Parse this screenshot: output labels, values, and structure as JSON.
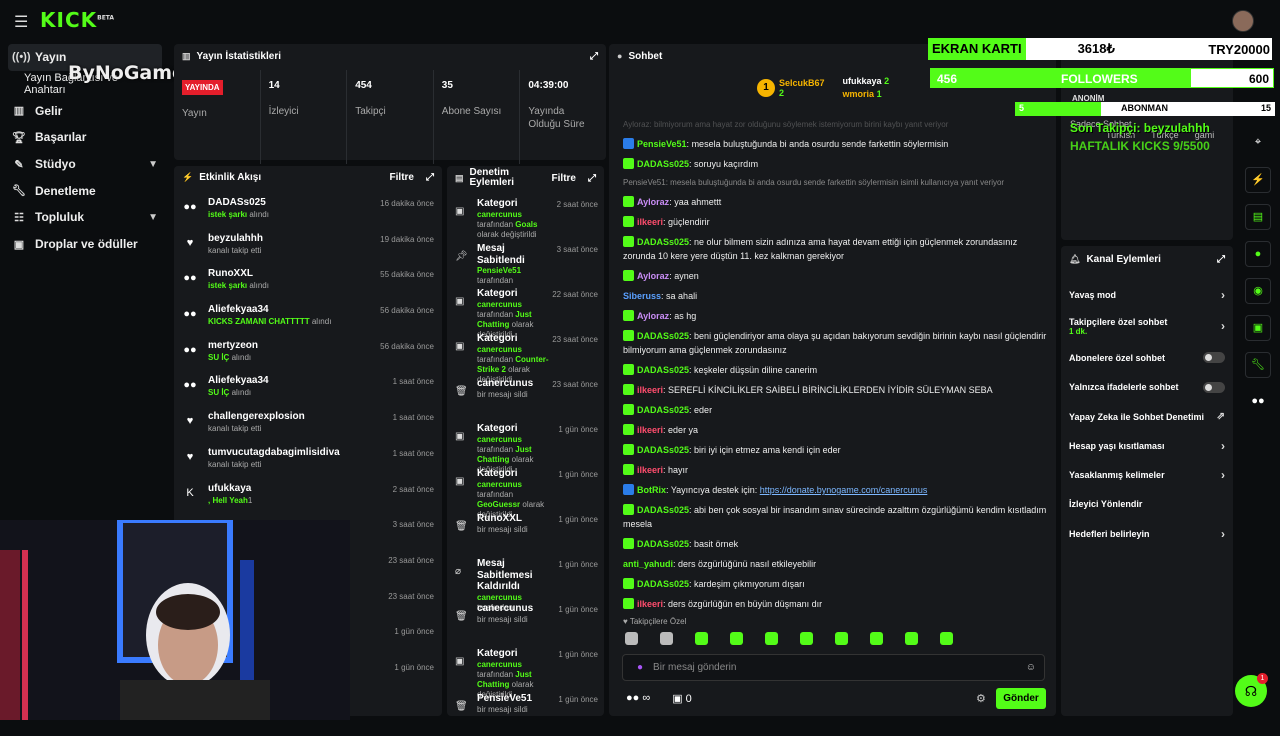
{
  "brand": {
    "logo": "KICK",
    "beta": "BETA"
  },
  "watermark": "ByNoGame",
  "sidebar": {
    "items": [
      {
        "label": "Yayın",
        "icon": "broadcast-icon"
      },
      {
        "label": "Yayın Bağlantısı ve Anahtarı"
      },
      {
        "label": "Gelir",
        "icon": "chart-icon"
      },
      {
        "label": "Başarılar",
        "icon": "trophy-icon"
      },
      {
        "label": "Stüdyo",
        "icon": "studio-icon"
      },
      {
        "label": "Denetleme",
        "icon": "wrench-icon"
      },
      {
        "label": "Topluluk",
        "icon": "community-icon"
      },
      {
        "label": "Droplar ve ödüller",
        "icon": "gift-icon"
      }
    ]
  },
  "stats": {
    "title": "Yayın İstatistikleri",
    "live": "YAYINDA",
    "items": [
      {
        "value": "",
        "label": "Yayın"
      },
      {
        "value": "14",
        "label": "İzleyici"
      },
      {
        "value": "454",
        "label": "Takipçi"
      },
      {
        "value": "35",
        "label": "Abone Sayısı"
      },
      {
        "value": "04:39:00",
        "label": "Yayında Olduğu Süre"
      }
    ]
  },
  "activity": {
    "title": "Etkinlik Akışı",
    "filter": "Filtre",
    "rows": [
      {
        "name": "DADASs025",
        "desc": "istek şarkı",
        "desc2": " alındı",
        "time": "16 dakika önce",
        "icon": "people-icon"
      },
      {
        "name": "beyzulahhh",
        "desc": "kanalı takip etti",
        "time": "19 dakika önce",
        "icon": "heart-icon"
      },
      {
        "name": "RunoXXL",
        "desc": "istek şarkı",
        "desc2": " alındı",
        "time": "55 dakika önce",
        "icon": "people-icon"
      },
      {
        "name": "Aliefekyaa34",
        "desc": "KICKS ZAMANI CHATTTTT",
        "desc2": " alındı",
        "time": "56 dakika önce",
        "icon": "people-icon"
      },
      {
        "name": "mertyzeon",
        "desc": "SU İÇ",
        "desc2": " alındı",
        "time": "56 dakika önce",
        "icon": "people-icon"
      },
      {
        "name": "Aliefekyaa34",
        "desc": "SU İÇ",
        "desc2": " alındı",
        "time": "1 saat önce",
        "icon": "people-icon"
      },
      {
        "name": "challengerexplosion",
        "desc": "kanalı takip etti",
        "time": "1 saat önce",
        "icon": "heart-icon"
      },
      {
        "name": "tumvucutagdabagimlisidiva",
        "desc": "kanalı takip etti",
        "time": "1 saat önce",
        "icon": "heart-icon"
      },
      {
        "name": "ufukkaya",
        "desc": ", Hell Yeah",
        "desc2": "1",
        "time": "2 saat önce",
        "icon": "kick-icon"
      }
    ],
    "extra_times": [
      "3 saat önce",
      "23 saat önce",
      "23 saat önce",
      "1 gün önce",
      "1 gün önce"
    ]
  },
  "moderation": {
    "title": "Denetim Eylemleri",
    "filter": "Filtre",
    "rows": [
      {
        "name": "Kategori",
        "by": "canercunus",
        "text": " tarafından ",
        "val": "Goals",
        "tail": " olarak değiştirildi",
        "time": "2 saat önce"
      },
      {
        "name": "Mesaj Sabitlendi",
        "by": "PensieVe51",
        "text": " tarafından",
        "val": "",
        "tail": "",
        "time": "3 saat önce"
      },
      {
        "name": "Kategori",
        "by": "canercunus",
        "text": " tarafından ",
        "val": "Just Chatting",
        "tail": " olarak değiştirildi",
        "time": "22 saat önce"
      },
      {
        "name": "Kategori",
        "by": "canercunus",
        "text": " tarafından ",
        "val": "Counter-Strike 2",
        "tail": " olarak değiştirildi",
        "time": "23 saat önce"
      },
      {
        "name": "canercunus",
        "by": "",
        "text": "bir mesajı sildi",
        "val": "",
        "tail": "",
        "time": "23 saat önce"
      },
      {
        "name": "Kategori",
        "by": "canercunus",
        "text": " tarafından ",
        "val": "Just Chatting",
        "tail": " olarak değiştirildi",
        "time": "1 gün önce"
      },
      {
        "name": "Kategori",
        "by": "canercunus",
        "text": " tarafından ",
        "val": "GeoGuessr",
        "tail": " olarak değiştirildi",
        "time": "1 gün önce"
      },
      {
        "name": "RunoXXL",
        "by": "",
        "text": "bir mesajı sildi",
        "val": "",
        "tail": "",
        "time": "1 gün önce"
      },
      {
        "name": "Mesaj Sabitlemesi Kaldırıldı",
        "by": "canercunus",
        "text": " tarafından",
        "val": "",
        "tail": "",
        "time": "1 gün önce"
      },
      {
        "name": "canercunus",
        "by": "",
        "text": "bir mesajı sildi",
        "val": "",
        "tail": "",
        "time": "1 gün önce"
      },
      {
        "name": "Kategori",
        "by": "canercunus",
        "text": " tarafından ",
        "val": "Just Chatting",
        "tail": " olarak değiştirildi",
        "time": "1 gün önce"
      },
      {
        "name": "PensieVe51",
        "by": "",
        "text": "bir mesajı sildi",
        "val": "",
        "tail": "",
        "time": "1 gün önce"
      }
    ]
  },
  "chat": {
    "title": "Sohbet",
    "top": [
      {
        "name": "SelcukB67",
        "count": "2"
      },
      {
        "name": "ufukkaya",
        "count": "2"
      },
      {
        "name": "wmoria",
        "count": "1"
      }
    ],
    "sys1": "Ayloraz: bilmiyorum ama hayat zor olduğunu söylemek istemiyorum birini kaybı yanıt veriyor",
    "messages": [
      {
        "user": "PensieVe51",
        "color": "#53fc18",
        "badge": "blue",
        "text": "mesela buluştuğunda bi anda osurdu sende farkettin söylermisin"
      },
      {
        "user": "DADASs025",
        "color": "#53fc18",
        "badge": "green",
        "text": "soruyu kaçırdım"
      },
      {
        "sys": "PensieVe51: mesela buluştuğunda bi anda osurdu sende farkettin söylermisin isimli kullanıcıya yanıt veriyor"
      },
      {
        "user": "Ayloraz",
        "color": "#c98df5",
        "badge": "green",
        "text": "yaa ahmettt"
      },
      {
        "user": "ilkeeri",
        "color": "#ff4d6d",
        "badge": "green",
        "text": "güçlendirir"
      },
      {
        "user": "DADASs025",
        "color": "#53fc18",
        "badge": "green",
        "text": "ne olur bilmem sizin adınıza ama hayat devam ettiği için güçlenmek zorundasınız zorunda 10 kere yere düştün 11. kez kalkman gerekiyor"
      },
      {
        "user": "Ayloraz",
        "color": "#c98df5",
        "badge": "green",
        "text": "aynen"
      },
      {
        "user": "Siberuss",
        "color": "#5aa0ff",
        "badge": "",
        "text": "sa ahali"
      },
      {
        "user": "Ayloraz",
        "color": "#c98df5",
        "badge": "green",
        "text": "as hg"
      },
      {
        "user": "DADASs025",
        "color": "#53fc18",
        "badge": "green",
        "text": "beni güçlendiriyor ama olaya şu açıdan bakıyorum sevdiğin birinin kaybı nasıl güçlendirir bilmiyorum ama güçlenmek zorundasınız"
      },
      {
        "user": "DADASs025",
        "color": "#53fc18",
        "badge": "green",
        "text": "keşkeler düşsün diline canerim"
      },
      {
        "user": "ilkeeri",
        "color": "#ff4d6d",
        "badge": "green",
        "text": "SEREFLİ KİNCİLİKLER SAİBELİ BİRİNCİLİKLERDEN İYİDİR SÜLEYMAN SEBA"
      },
      {
        "user": "DADASs025",
        "color": "#53fc18",
        "badge": "green",
        "text": "eder"
      },
      {
        "user": "ilkeeri",
        "color": "#ff4d6d",
        "badge": "green",
        "text": "eder ya"
      },
      {
        "user": "DADASs025",
        "color": "#53fc18",
        "badge": "green",
        "text": "biri iyi için etmez ama kendi için eder"
      },
      {
        "user": "ilkeeri",
        "color": "#ff4d6d",
        "badge": "green",
        "text": "hayır"
      },
      {
        "user": "BotRix",
        "color": "#53fc18",
        "badge": "blue",
        "text": "Yayıncıya destek için: ",
        "link": "https://donate.bynogame.com/canercunus"
      },
      {
        "user": "DADASs025",
        "color": "#53fc18",
        "badge": "green",
        "text": "abi ben çok sosyal bir insandım sınav sürecinde azalttım özgürlüğümü kendim kısıtladım mesela"
      },
      {
        "user": "DADASs025",
        "color": "#53fc18",
        "badge": "green",
        "text": "basit örnek"
      },
      {
        "user": "anti_yahudi",
        "color": "#53fc18",
        "badge": "",
        "text": "ders özgürlüğünü nasıl etkileyebilir"
      },
      {
        "user": "DADASs025",
        "color": "#53fc18",
        "badge": "green",
        "text": "kardeşim çıkmıyorum dışarı"
      },
      {
        "user": "ilkeeri",
        "color": "#ff4d6d",
        "badge": "green",
        "text": "ders özgürlüğün en büyün düşmanı dır"
      }
    ],
    "followers_only": "Takipçilere Özel",
    "input_placeholder": "Bir mesaj gönderin",
    "points": "∞",
    "items_count": "0",
    "send": "Gönder"
  },
  "channel_actions": {
    "title": "Kanal Eylemleri",
    "rows": [
      {
        "label": "Yavaş mod",
        "type": "chevron"
      },
      {
        "label": "Takipçilere özel sohbet",
        "sub": "1 dk.",
        "type": "chevron"
      },
      {
        "label": "Abonelere özel sohbet",
        "type": "toggle"
      },
      {
        "label": "Yalnızca ifadelerle sohbet",
        "type": "toggle"
      },
      {
        "label": "Yapay Zeka ile Sohbet Denetimi",
        "type": "external"
      },
      {
        "label": "Hesap yaşı kısıtlaması",
        "type": "chevron"
      },
      {
        "label": "Yasaklanmış kelimeler",
        "type": "chevron"
      },
      {
        "label": "İzleyici Yönlendir",
        "type": "none"
      },
      {
        "label": "Hedefleri belirleyin",
        "type": "chevron"
      }
    ]
  },
  "overlay": {
    "gpu_label": "EKRAN KARTI",
    "gpu_value": "3618₺",
    "gpu_goal": "TRY20000",
    "followers_count": "456",
    "followers_label": "FOLLOWERS",
    "followers_goal": "600",
    "followers_progress": 0.76,
    "sub_count": "5",
    "sub_label": "ABONMAN",
    "sub_goal": "15",
    "sub_progress": 0.33,
    "last_follower": "Son Takipçi: beyzulahhh",
    "weekly": "HAFTALIK KICKS 9/5500",
    "ghost1": "ANONİM",
    "ghost2": "Sadece Sohbet",
    "ghost3": "Turkish",
    "ghost4": "Türkçe",
    "ghost5": "gami"
  },
  "fab_badge": "1"
}
